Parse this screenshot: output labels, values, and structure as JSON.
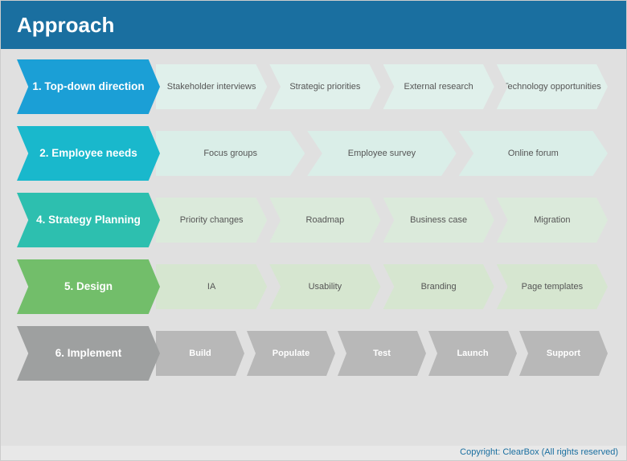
{
  "title": "Approach",
  "rows": [
    {
      "id": "row1",
      "label": "1. Top-down direction",
      "colorClass": "blue1",
      "itemColor": "c-light1",
      "items": [
        "Stakeholder interviews",
        "Strategic priorities",
        "External research",
        "Technology opportunities"
      ]
    },
    {
      "id": "row2",
      "label": "2. Employee needs",
      "colorClass": "blue2",
      "itemColor": "c-light2",
      "items": [
        "Focus groups",
        "Employee survey",
        "Online forum"
      ]
    },
    {
      "id": "row3",
      "label": "4. Strategy Planning",
      "colorClass": "teal",
      "itemColor": "c-light3",
      "items": [
        "Priority changes",
        "Roadmap",
        "Business case",
        "Migration"
      ]
    },
    {
      "id": "row4",
      "label": "5. Design",
      "colorClass": "green",
      "itemColor": "c-light4",
      "items": [
        "IA",
        "Usability",
        "Branding",
        "Page templates"
      ]
    },
    {
      "id": "row5",
      "label": "6. Implement",
      "colorClass": "gray",
      "itemColor": "c-gray",
      "items": [
        "Build",
        "Populate",
        "Test",
        "Launch",
        "Support"
      ]
    }
  ],
  "copyright": "Copyright: ClearBox (All rights reserved)"
}
